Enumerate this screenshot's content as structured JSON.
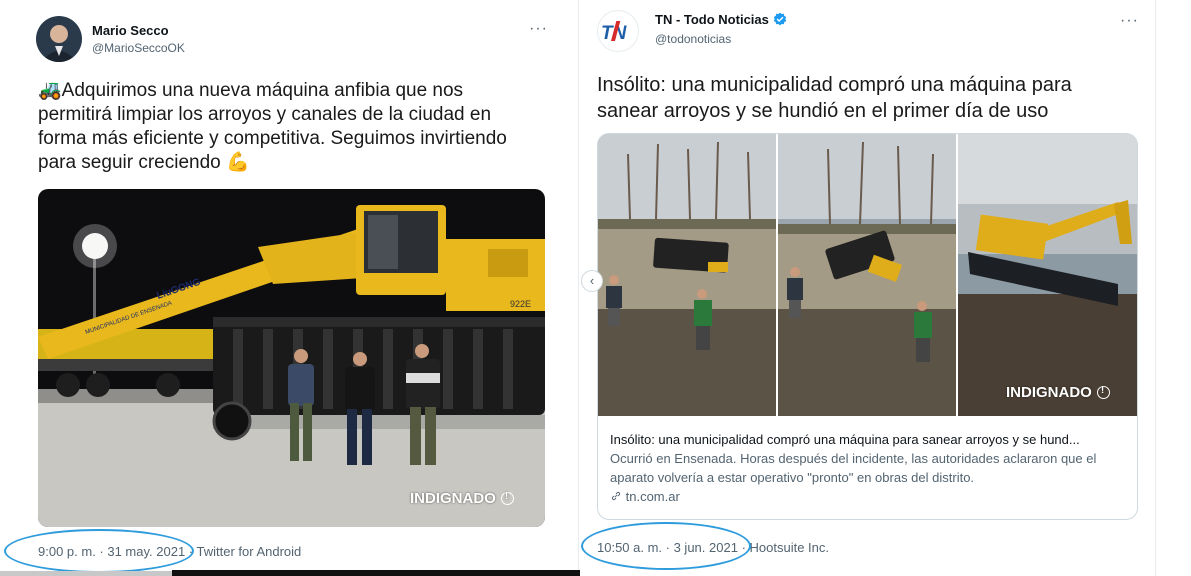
{
  "left_tweet": {
    "name": "Mario Secco",
    "handle": "@MarioSeccoOK",
    "more": "···",
    "text_emoji_start": "🚜",
    "text": "Adquirimos una nueva máquina anfibia que nos permitirá limpiar los arroyos y canales de la ciudad en forma más eficiente y competitiva. Seguimos invirtiendo para seguir creciendo",
    "text_emoji_end": "💪",
    "machine_brand": "LiuGONG",
    "machine_label": "MUNICIPALIDAD DE ENSENADA",
    "machine_model": "922E",
    "watermark": "INDIGNADO",
    "timestamp": "9:00 p. m. · 31 may. 2021",
    "source": "· Twitter for Android"
  },
  "right_tweet": {
    "name": "TN - Todo Noticias",
    "handle": "@todonoticias",
    "verified": true,
    "logo_text": "TN",
    "more": "···",
    "text": "Insólito: una municipalidad compró una máquina para sanear arroyos y se hundió en el primer día de uso",
    "watermark": "INDIGNADO",
    "card": {
      "title": "Insólito: una municipalidad compró una máquina para sanear arroyos y se hund...",
      "description": "Ocurrió en Ensenada. Horas después del incidente, las autoridades aclararon que el aparato volvería a estar operativo \"pronto\" en obras del distrito.",
      "domain": "tn.com.ar"
    },
    "timestamp": "10:50 a. m. · 3 jun. 2021",
    "source": "· Hootsuite Inc."
  },
  "colors": {
    "accent": "#1d9bf0",
    "annotation_circle": "#2e9bdc",
    "machine_yellow": "#e8b81c",
    "muted_text": "#536471"
  },
  "icons": {
    "verified": "verified-badge-icon",
    "link": "link-icon",
    "more": "more-icon",
    "carousel_prev": "chevron-left-icon"
  }
}
